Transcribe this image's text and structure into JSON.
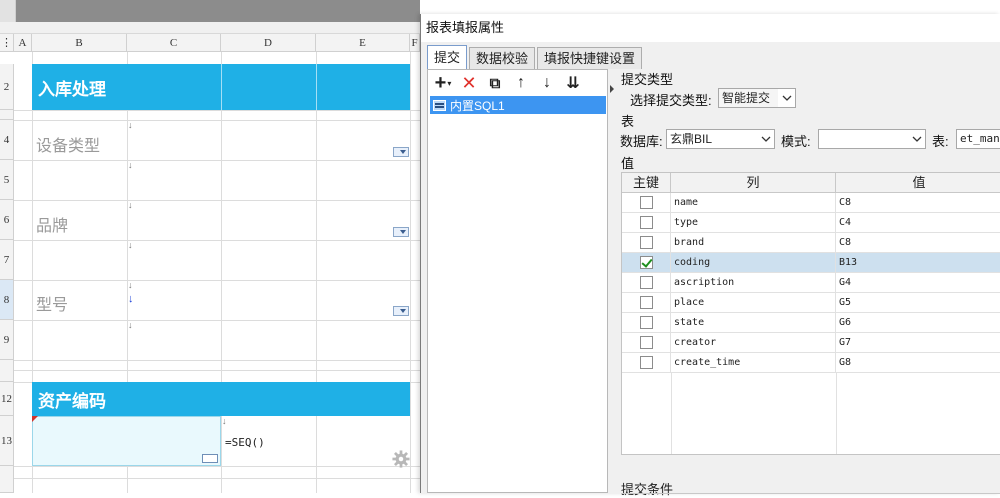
{
  "sheet": {
    "columns": [
      "A",
      "B",
      "C",
      "D",
      "E",
      "F"
    ],
    "rows": [
      "2",
      "4",
      "5",
      "6",
      "7",
      "8",
      "9",
      "12",
      "13"
    ],
    "header_title": "入库处理",
    "labels": {
      "device_type": "设备类型",
      "brand": "品牌",
      "model": "型号"
    },
    "asset_code_title": "资产编码",
    "formula": "=SEQ()",
    "colors": {
      "header_band": "#1fb0e6",
      "selected_cell": "#e9f9fd"
    }
  },
  "dialog": {
    "title": "报表填报属性",
    "tabs": [
      "提交",
      "数据校验",
      "填报快捷键设置"
    ],
    "toolbar": {
      "add": "+",
      "delete": "✕",
      "copy": "⧉",
      "up": "↑",
      "down": "↓",
      "sort": "⇊"
    },
    "sql_item": "内置SQL1",
    "submit_type": {
      "section": "提交类型",
      "label": "选择提交类型:",
      "value": "智能提交"
    },
    "table_section": {
      "section": "表",
      "db_label": "数据库:",
      "db_value": "玄鼎BIL",
      "mode_label": "模式:",
      "mode_value": "",
      "table_label": "表:",
      "table_value": "et_mana"
    },
    "values": {
      "section": "值",
      "headers": [
        "主键",
        "列",
        "值"
      ],
      "rows": [
        {
          "key": false,
          "column": "name",
          "value": "C8"
        },
        {
          "key": false,
          "column": "type",
          "value": "C4"
        },
        {
          "key": false,
          "column": "brand",
          "value": "C8"
        },
        {
          "key": true,
          "column": "coding",
          "value": "B13"
        },
        {
          "key": false,
          "column": "ascription",
          "value": "G4"
        },
        {
          "key": false,
          "column": "place",
          "value": "G5"
        },
        {
          "key": false,
          "column": "state",
          "value": "G6"
        },
        {
          "key": false,
          "column": "creator",
          "value": "G7"
        },
        {
          "key": false,
          "column": "create_time",
          "value": "G8"
        }
      ]
    },
    "submit_condition": "提交条件"
  }
}
